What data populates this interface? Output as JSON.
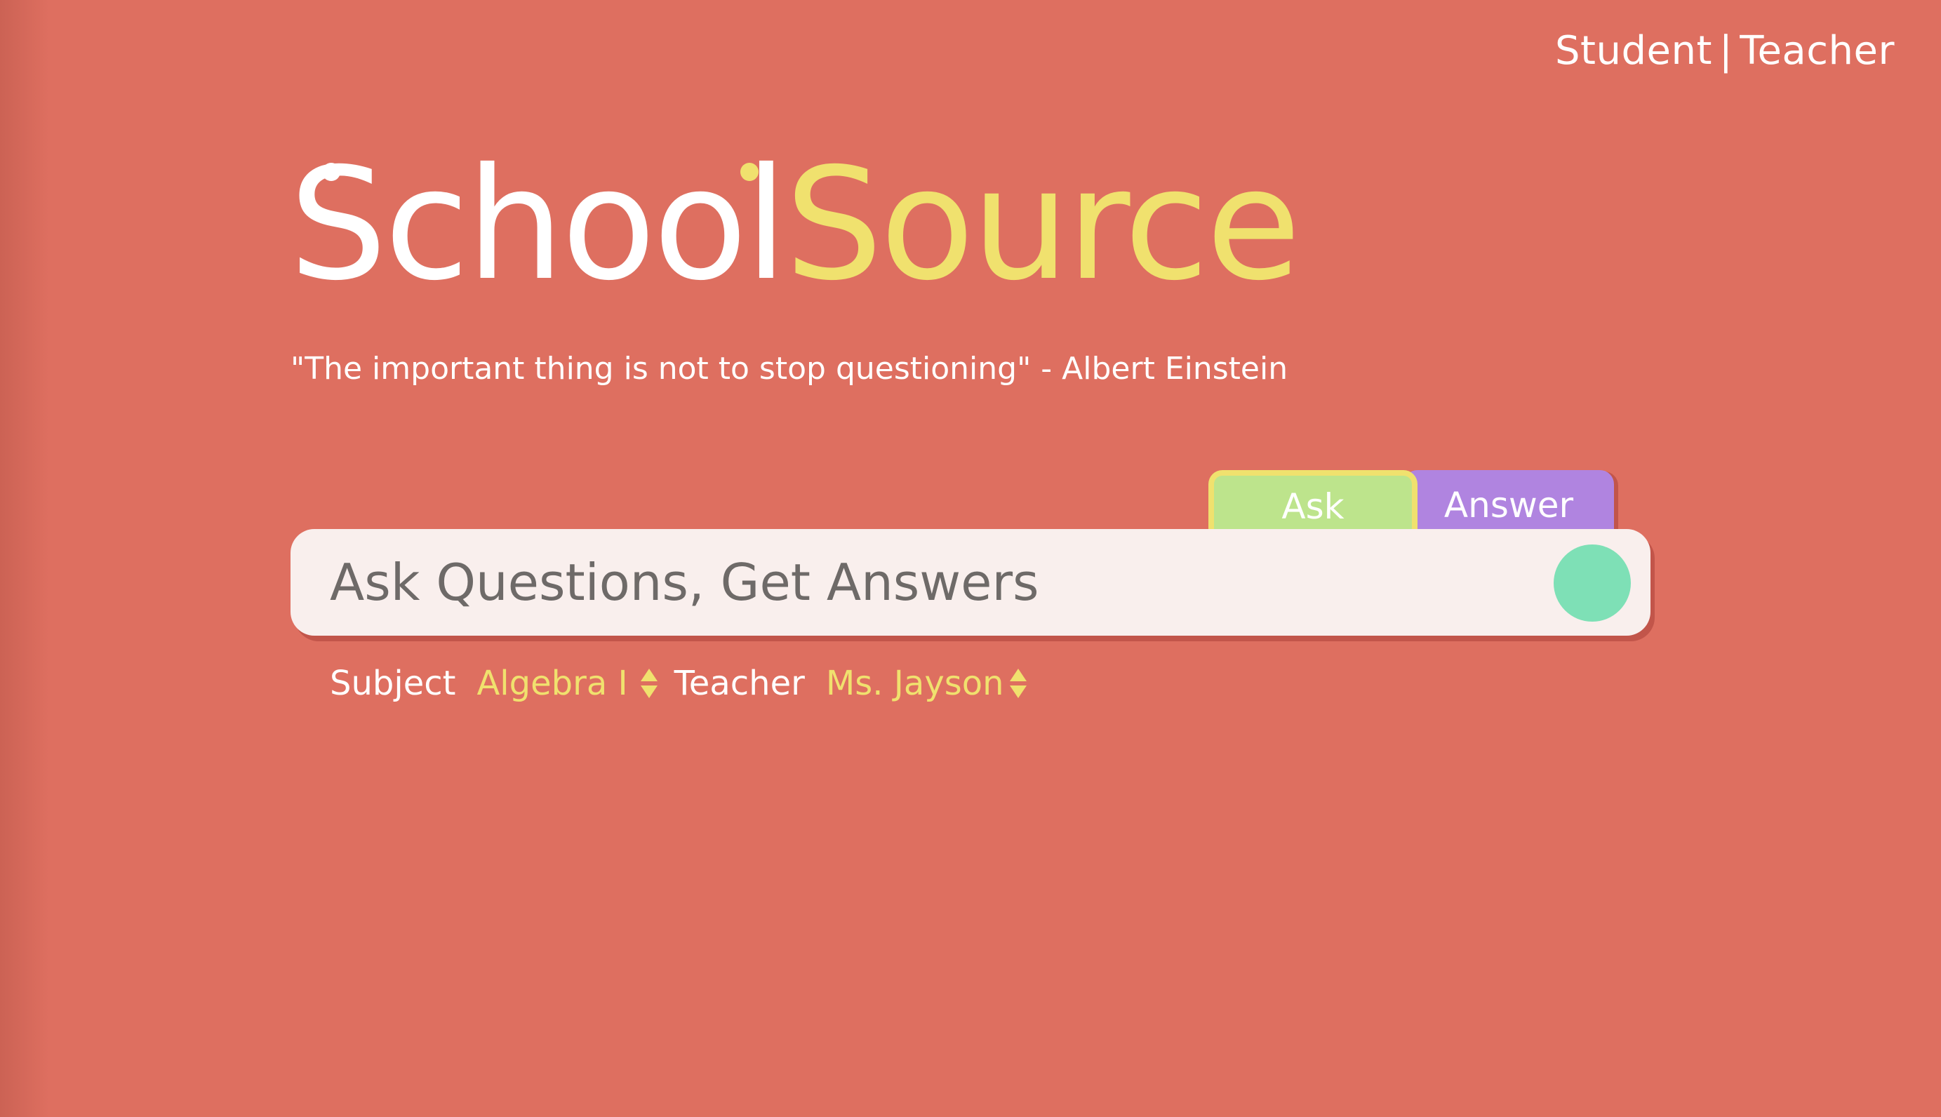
{
  "header": {
    "role_student": "Student",
    "role_separator": "|",
    "role_teacher": "Teacher"
  },
  "logo": {
    "part1": "School",
    "part2": "Source"
  },
  "quote": "\"The important thing is not to stop questioning\" - Albert Einstein",
  "tabs": {
    "ask": "Ask",
    "answer": "Answer",
    "active": "Ask"
  },
  "search": {
    "placeholder": "Ask Questions, Get Answers"
  },
  "filters": {
    "subject_label": "Subject",
    "subject_value": "Algebra I",
    "teacher_label": "Teacher",
    "teacher_value": "Ms. Jayson"
  },
  "colors": {
    "background": "#de6f60",
    "accent_yellow": "#f0e16e",
    "ask_tab": "#bde48c",
    "answer_tab": "#b084e0",
    "submit_button": "#7ee0b6",
    "search_bg": "#f9efed"
  }
}
